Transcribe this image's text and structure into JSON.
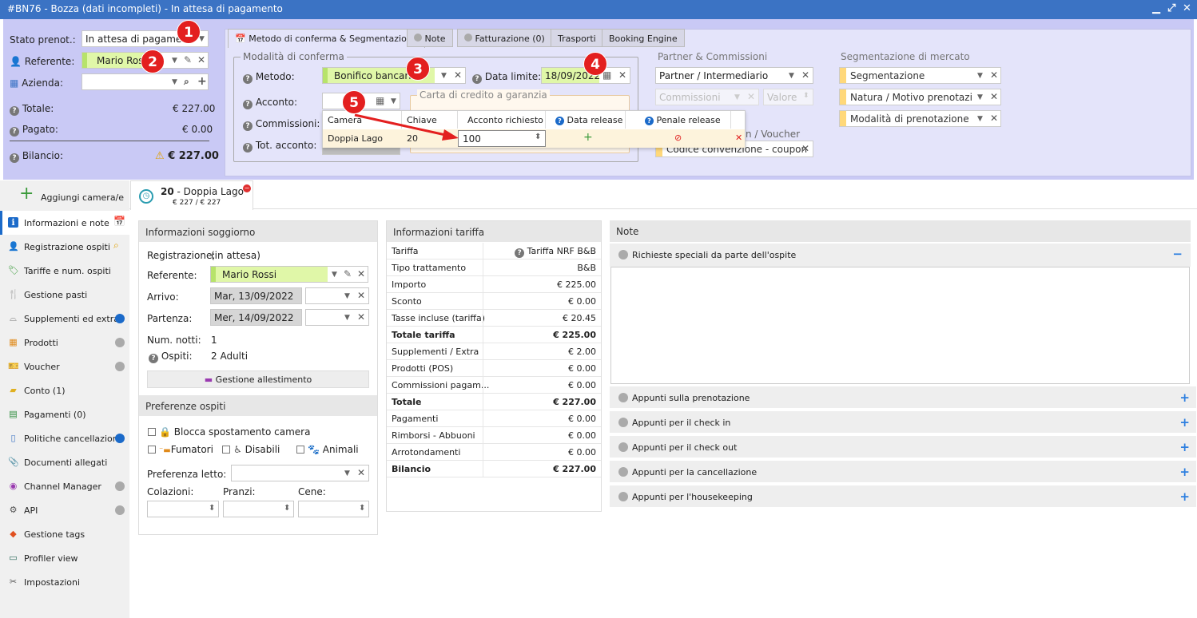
{
  "window": {
    "title": "#BN76 - Bozza (dati incompleti) - In attesa di pagamento",
    "icons": [
      "minimize-icon",
      "maximize-icon",
      "close-icon"
    ]
  },
  "left_header": {
    "stato_label": "Stato prenot.:",
    "stato_value": "In attesa di pagamento",
    "referente_label": "Referente:",
    "referente_value": "Mario Rossi",
    "azienda_label": "Azienda:",
    "azienda_value": "",
    "totale_label": "Totale:",
    "totale_value": "€ 227.00",
    "pagato_label": "Pagato:",
    "pagato_value": "€ 0.00",
    "bilancio_label": "Bilancio:",
    "bilancio_value": "€ 227.00"
  },
  "tabs": [
    {
      "label": "Metodo di conferma & Segmentazione",
      "active": true
    },
    {
      "label": "Note"
    },
    {
      "label": "Fatturazione (0)"
    },
    {
      "label": "Trasporti"
    },
    {
      "label": "Booking Engine"
    }
  ],
  "conferma": {
    "legend": "Modalità di conferma",
    "metodo_label": "Metodo:",
    "metodo_value": "Bonifico bancario",
    "data_limite_label": "Data limite:",
    "data_limite_value": "18/09/2022",
    "acconto_label": "Acconto:",
    "commissioni_label": "Commissioni:",
    "tot_acconto_label": "Tot. acconto:",
    "carta_legend": "Carta di credito a garanzia"
  },
  "popup": {
    "headers": [
      "Camera",
      "Chiave",
      "Acconto richiesto",
      "Data release",
      "Penale release"
    ],
    "row": {
      "camera": "Doppia Lago",
      "chiave": "20",
      "acconto": "100"
    }
  },
  "partner": {
    "title": "Partner & Commissioni",
    "partner_value": "Partner / Intermediario",
    "commissioni_ph": "Commissioni",
    "valore_ph": "Valore",
    "voucher_title_partial": "n / Voucher",
    "codice_value": "Codice convenzione - coupon"
  },
  "segmentazione": {
    "title": "Segmentazione di mercato",
    "items": [
      "Segmentazione",
      "Natura / Motivo prenotazione",
      "Modalità di prenotazione"
    ]
  },
  "badges": [
    "1",
    "2",
    "3",
    "4",
    "5"
  ],
  "room_bar": {
    "add_label": "Aggiungi camera/e",
    "room_num": "20",
    "room_name": "Doppia Lago",
    "room_price": "€ 227 / € 227"
  },
  "nav": [
    {
      "label": "Informazioni e note",
      "icon": "info-icon",
      "active": true,
      "dot": ""
    },
    {
      "label": "Registrazione ospiti",
      "icon": "user-icon",
      "dot": ""
    },
    {
      "label": "Tariffe e num. ospiti",
      "icon": "tag-icon",
      "dot": ""
    },
    {
      "label": "Gestione pasti",
      "icon": "cutlery-icon",
      "dot": ""
    },
    {
      "label": "Supplementi ed extra",
      "icon": "cloche-icon",
      "dot": "blue"
    },
    {
      "label": "Prodotti",
      "icon": "boxes-icon",
      "dot": "gray"
    },
    {
      "label": "Voucher",
      "icon": "voucher-icon",
      "dot": "gray"
    },
    {
      "label": "Conto (1)",
      "icon": "folder-icon",
      "dot": ""
    },
    {
      "label": "Pagamenti (0)",
      "icon": "money-icon",
      "dot": ""
    },
    {
      "label": "Politiche cancellazione",
      "icon": "document-icon",
      "dot": "blue"
    },
    {
      "label": "Documenti allegati",
      "icon": "paperclip-icon",
      "dot": ""
    },
    {
      "label": "Channel Manager",
      "icon": "broadcast-icon",
      "dot": "gray"
    },
    {
      "label": "API",
      "icon": "gear-icon",
      "dot": "gray"
    },
    {
      "label": "Gestione tags",
      "icon": "tags-icon",
      "dot": ""
    },
    {
      "label": "Profiler view",
      "icon": "monitor-icon",
      "dot": ""
    },
    {
      "label": "Impostazioni",
      "icon": "tools-icon",
      "dot": ""
    }
  ],
  "soggiorno": {
    "title": "Informazioni soggiorno",
    "registrazione_label": "Registrazione:",
    "registrazione_value": "(in attesa)",
    "referente_label": "Referente:",
    "referente_value": "Mario Rossi",
    "arrivo_label": "Arrivo:",
    "arrivo_value": "Mar, 13/09/2022",
    "partenza_label": "Partenza:",
    "partenza_value": "Mer, 14/09/2022",
    "notti_label": "Num. notti:",
    "notti_value": "1",
    "ospiti_label": "Ospiti:",
    "ospiti_value": "2 Adulti",
    "allestimento_label": "Gestione allestimento"
  },
  "preferenze": {
    "title": "Preferenze ospiti",
    "blocca": "Blocca spostamento camera",
    "fumatori": "Fumatori",
    "disabili": "Disabili",
    "animali": "Animali",
    "letto_label": "Preferenza letto:",
    "colazioni": "Colazioni:",
    "pranzi": "Pranzi:",
    "cene": "Cene:"
  },
  "tariffa": {
    "title": "Informazioni tariffa",
    "rows": [
      {
        "k": "Tariffa",
        "v": "Tariffa NRF B&B"
      },
      {
        "k": "Tipo trattamento",
        "v": "B&B"
      },
      {
        "k": "Importo",
        "v": "€ 225.00"
      },
      {
        "k": "Sconto",
        "v": "€ 0.00"
      },
      {
        "k": "Tasse incluse (tariffa)",
        "v": "€ 20.45"
      },
      {
        "k": "Totale tariffa",
        "v": "€ 225.00",
        "bold": true
      },
      {
        "k": "Supplementi / Extra",
        "v": "€ 2.00"
      },
      {
        "k": "Prodotti (POS)",
        "v": "€ 0.00"
      },
      {
        "k": "Commissioni pagam...",
        "v": "€ 0.00"
      },
      {
        "k": "Totale",
        "v": "€ 227.00",
        "bold": true
      },
      {
        "k": "Pagamenti",
        "v": "€ 0.00"
      },
      {
        "k": "Rimborsi - Abbuoni",
        "v": "€ 0.00"
      },
      {
        "k": "Arrotondamenti",
        "v": "€ 0.00"
      },
      {
        "k": "Bilancio",
        "v": "€ 227.00",
        "bold": true
      }
    ]
  },
  "note": {
    "title": "Note",
    "richieste": "Richieste speciali da parte dell'ospite",
    "items": [
      "Appunti sulla prenotazione",
      "Appunti per il check in",
      "Appunti per il check out",
      "Appunti per la cancellazione",
      "Appunti per l'housekeeping"
    ]
  },
  "colors": {
    "title_bar": "#3b73c4",
    "header_bg": "#c9c9f5",
    "highlight": "#e0f7a8",
    "badge": "#e31f1f",
    "accent_blue": "#1b6ac9"
  }
}
